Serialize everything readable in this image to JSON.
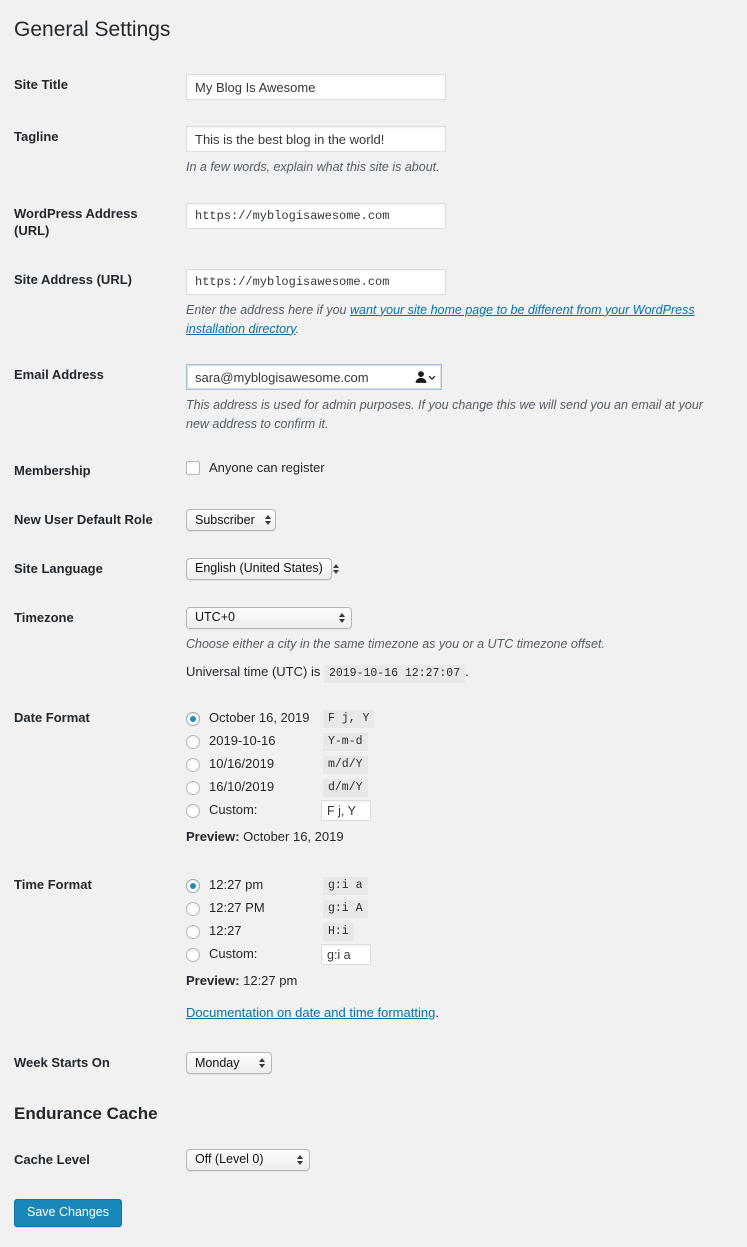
{
  "page": {
    "title": "General Settings"
  },
  "fields": {
    "site_title": {
      "label": "Site Title",
      "value": "My Blog Is Awesome"
    },
    "tagline": {
      "label": "Tagline",
      "value": "This is the best blog in the world!",
      "description": "In a few words, explain what this site is about."
    },
    "wp_address": {
      "label": "WordPress Address (URL)",
      "value": "https://myblogisawesome.com"
    },
    "site_address": {
      "label": "Site Address (URL)",
      "value": "https://myblogisawesome.com",
      "desc_prefix": "Enter the address here if you ",
      "desc_link": "want your site home page to be different from your WordPress installation directory",
      "desc_suffix": "."
    },
    "email_address": {
      "label": "Email Address",
      "value": "sara@myblogisawesome.com",
      "description": "This address is used for admin purposes. If you change this we will send you an email at your new address to confirm it.",
      "autofill_icon": "person-autofill-icon"
    },
    "membership": {
      "label": "Membership",
      "checkbox_label": "Anyone can register",
      "checked": false
    },
    "default_role": {
      "label": "New User Default Role",
      "value": "Subscriber"
    },
    "site_language": {
      "label": "Site Language",
      "value": "English (United States)"
    },
    "timezone": {
      "label": "Timezone",
      "value": "UTC+0",
      "description": "Choose either a city in the same timezone as you or a UTC timezone offset.",
      "utc_prefix": "Universal time (UTC) is",
      "utc_value": "2019-10-16 12:27:07",
      "utc_suffix": "."
    },
    "date_format": {
      "label": "Date Format",
      "options": [
        {
          "text": "October 16, 2019",
          "code": "F j, Y",
          "selected": true,
          "is_custom": false
        },
        {
          "text": "2019-10-16",
          "code": "Y-m-d",
          "selected": false,
          "is_custom": false
        },
        {
          "text": "10/16/2019",
          "code": "m/d/Y",
          "selected": false,
          "is_custom": false
        },
        {
          "text": "16/10/2019",
          "code": "d/m/Y",
          "selected": false,
          "is_custom": false
        },
        {
          "text": "Custom:",
          "code": "F j, Y",
          "selected": false,
          "is_custom": true
        }
      ],
      "preview_label": "Preview:",
      "preview_value": "October 16, 2019"
    },
    "time_format": {
      "label": "Time Format",
      "options": [
        {
          "text": "12:27 pm",
          "code": "g:i a",
          "selected": true,
          "is_custom": false
        },
        {
          "text": "12:27 PM",
          "code": "g:i A",
          "selected": false,
          "is_custom": false
        },
        {
          "text": "12:27",
          "code": "H:i",
          "selected": false,
          "is_custom": false
        },
        {
          "text": "Custom:",
          "code": "g:i a",
          "selected": false,
          "is_custom": true
        }
      ],
      "preview_label": "Preview:",
      "preview_value": "12:27 pm",
      "doc_link": "Documentation on date and time formatting",
      "doc_suffix": "."
    },
    "week_starts_on": {
      "label": "Week Starts On",
      "value": "Monday"
    },
    "cache_level": {
      "label": "Cache Level",
      "value": "Off (Level 0)"
    }
  },
  "sections": {
    "endurance_cache": "Endurance Cache"
  },
  "actions": {
    "save_label": "Save Changes"
  },
  "colors": {
    "page_background": "#f1f1f1",
    "accent_link": "#0073aa",
    "primary_button": "#1a87b9",
    "radio_dot": "#1e8cbe"
  }
}
